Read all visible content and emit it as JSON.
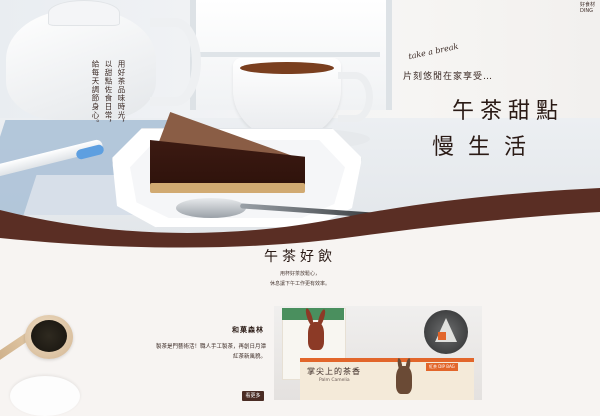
{
  "brand": {
    "logo_line1": "好食材",
    "logo_line2": "DING"
  },
  "hero": {
    "script": "take a break",
    "subtitle": "片刻悠閒在家享受…",
    "title_line1": "午茶甜點",
    "title_line2": "慢生活",
    "side_text_col1": "用好茶品味時光，",
    "side_text_col2": "以甜點佐食日常，",
    "side_text_col3": "給每天調節身心。"
  },
  "section": {
    "title": "午茶好飲",
    "desc_line1": "用杯好茶放鬆心，",
    "desc_line2": "休息讓下午工作更有效率。"
  },
  "product": {
    "name": "和菓森林",
    "desc_line1": "製茶是門藝術活！職人手工製茶，再創日月潭",
    "desc_line2": "紅茶新風貌。",
    "more_label": "看更多",
    "box_name": "掌尖上的茶香",
    "box_en": "Palm Camelia",
    "box_label": "紅茶 DIP BAG"
  },
  "colors": {
    "accent": "#4a2c24",
    "background": "#f7f4f2",
    "box_orange": "#e2662b"
  }
}
